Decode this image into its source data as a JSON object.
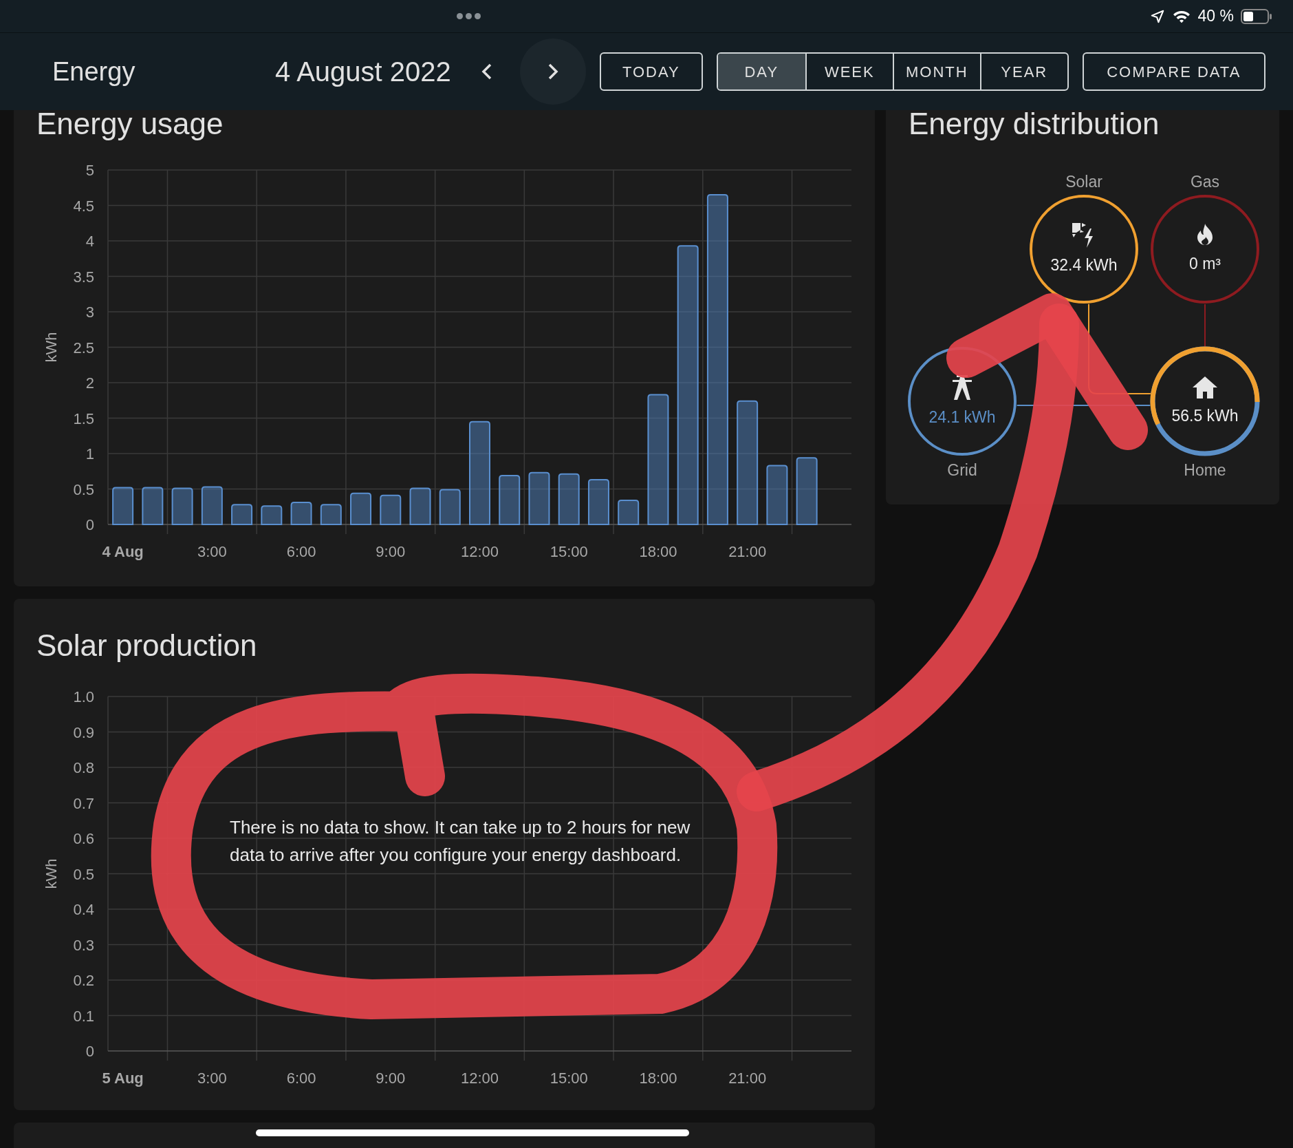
{
  "status_bar": {
    "battery": "40 %"
  },
  "header": {
    "title": "Energy",
    "date": "4 August 2022",
    "today_button": "TODAY",
    "compare_button": "COMPARE DATA",
    "periods": [
      {
        "label": "DAY",
        "selected": true
      },
      {
        "label": "WEEK",
        "selected": false
      },
      {
        "label": "MONTH",
        "selected": false
      },
      {
        "label": "YEAR",
        "selected": false
      }
    ]
  },
  "energy_usage": {
    "title": "Energy usage",
    "chart_data": {
      "type": "bar",
      "ylabel": "kWh",
      "ylim": [
        0,
        5
      ],
      "xlim": [
        -0.5,
        24.5
      ],
      "grid": true,
      "yticks": [
        {
          "value": 0,
          "label": "0"
        },
        {
          "value": 0.5,
          "label": "0.5"
        },
        {
          "value": 1,
          "label": "1"
        },
        {
          "value": 1.5,
          "label": "1.5"
        },
        {
          "value": 2,
          "label": "2"
        },
        {
          "value": 2.5,
          "label": "2.5"
        },
        {
          "value": 3,
          "label": "3"
        },
        {
          "value": 3.5,
          "label": "3.5"
        },
        {
          "value": 4,
          "label": "4"
        },
        {
          "value": 4.5,
          "label": "4.5"
        },
        {
          "value": 5,
          "label": "5"
        }
      ],
      "xticks": [
        {
          "value": 0,
          "label": "4 Aug"
        },
        {
          "value": 3,
          "label": "3:00"
        },
        {
          "value": 6,
          "label": "6:00"
        },
        {
          "value": 9,
          "label": "9:00"
        },
        {
          "value": 12,
          "label": "12:00"
        },
        {
          "value": 15,
          "label": "15:00"
        },
        {
          "value": 18,
          "label": "18:00"
        },
        {
          "value": 21,
          "label": "21:00"
        }
      ],
      "x": [
        0,
        1,
        2,
        3,
        4,
        5,
        6,
        7,
        8,
        9,
        10,
        11,
        12,
        13,
        14,
        15,
        16,
        17,
        18,
        19,
        20,
        21,
        22,
        23
      ],
      "values": [
        0.52,
        0.52,
        0.51,
        0.53,
        0.28,
        0.26,
        0.31,
        0.28,
        0.44,
        0.41,
        0.51,
        0.49,
        1.45,
        0.69,
        0.73,
        0.71,
        0.63,
        0.34,
        1.83,
        3.93,
        4.65,
        1.74,
        0.83,
        0.94
      ]
    }
  },
  "energy_distribution": {
    "title": "Energy distribution",
    "nodes": [
      {
        "kind": "solar",
        "label": "Solar",
        "value": "32.4 kWh"
      },
      {
        "kind": "gas",
        "label": "Gas",
        "value": "0 m³"
      },
      {
        "kind": "grid",
        "label": "Grid",
        "value": "24.1 kWh"
      },
      {
        "kind": "home",
        "label": "Home",
        "value": "56.5 kWh"
      }
    ]
  },
  "solar_production": {
    "title": "Solar production",
    "message": "There is no data to show. It can take up to 2 hours for new data to arrive after you configure your energy dashboard.",
    "chart_data": {
      "type": "bar",
      "ylabel": "kWh",
      "ylim": [
        0,
        1
      ],
      "xlim": [
        -0.5,
        24.5
      ],
      "grid": true,
      "yticks": [
        {
          "value": 0,
          "label": "0"
        },
        {
          "value": 0.1,
          "label": "0.1"
        },
        {
          "value": 0.2,
          "label": "0.2"
        },
        {
          "value": 0.3,
          "label": "0.3"
        },
        {
          "value": 0.4,
          "label": "0.4"
        },
        {
          "value": 0.5,
          "label": "0.5"
        },
        {
          "value": 0.6,
          "label": "0.6"
        },
        {
          "value": 0.7,
          "label": "0.7"
        },
        {
          "value": 0.8,
          "label": "0.8"
        },
        {
          "value": 0.9,
          "label": "0.9"
        },
        {
          "value": 1,
          "label": "1.0"
        }
      ],
      "xticks": [
        {
          "value": 0,
          "label": "5 Aug"
        },
        {
          "value": 3,
          "label": "3:00"
        },
        {
          "value": 6,
          "label": "6:00"
        },
        {
          "value": 9,
          "label": "9:00"
        },
        {
          "value": 12,
          "label": "12:00"
        },
        {
          "value": 15,
          "label": "15:00"
        },
        {
          "value": 18,
          "label": "18:00"
        },
        {
          "value": 21,
          "label": "21:00"
        }
      ]
    }
  }
}
